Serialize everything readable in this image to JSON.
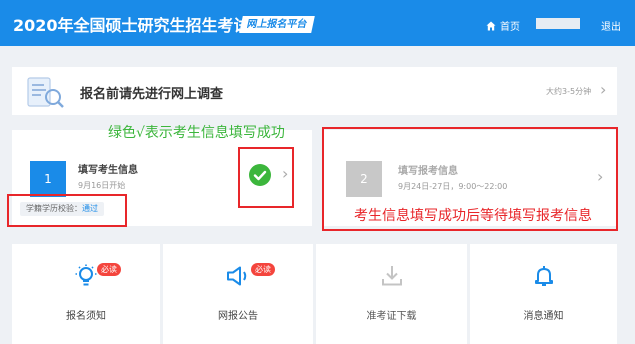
{
  "header": {
    "title": "2020年全国硕士研究生招生考试",
    "platform": "网上报名平台",
    "home": "首页",
    "logout": "退出"
  },
  "survey": {
    "title": "报名前请先进行网上调查",
    "time": "大约3-5分钟"
  },
  "annotations": {
    "green": "绿色√表示考生信息填写成功",
    "red": "考生信息填写成功后等待填写报考信息"
  },
  "steps": [
    {
      "number": "1",
      "title": "填写考生信息",
      "date": "9月16日开始",
      "verify_label": "学籍学历校验：",
      "verify_status": "通过"
    },
    {
      "number": "2",
      "title": "填写报考信息",
      "date": "9月24日-27日，9:00～22:00"
    }
  ],
  "menu": [
    {
      "label": "报名须知",
      "badge": "必读",
      "icon": "lightbulb-icon"
    },
    {
      "label": "网报公告",
      "badge": "必读",
      "icon": "megaphone-icon"
    },
    {
      "label": "准考证下载",
      "badge": "",
      "icon": "download-icon"
    },
    {
      "label": "消息通知",
      "badge": "",
      "icon": "bell-icon"
    }
  ],
  "colors": {
    "primary": "#1a8be8",
    "success": "#3cb63c",
    "annotation": "#e8262a",
    "badge": "#f4453d"
  }
}
